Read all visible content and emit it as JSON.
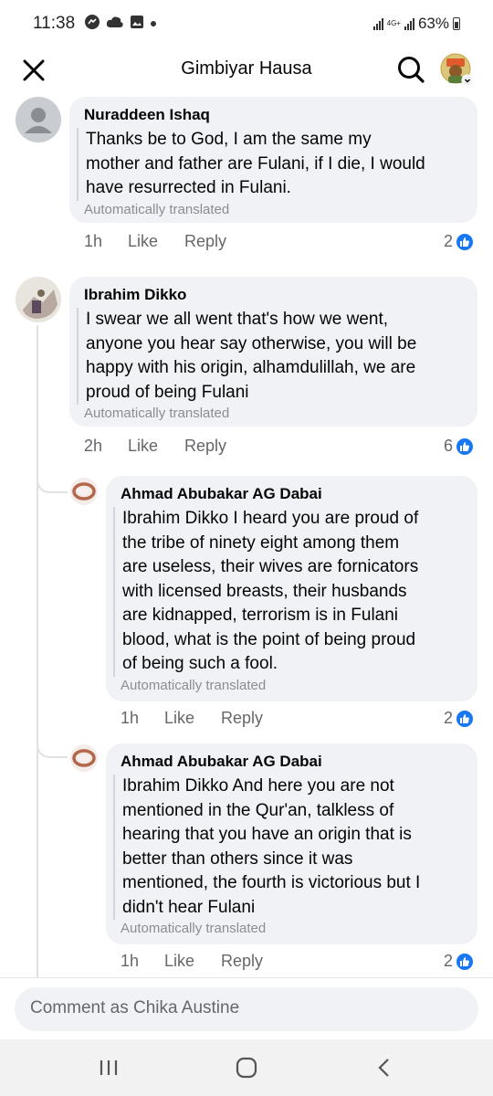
{
  "status_bar": {
    "time": "11:38",
    "network": "4G+",
    "battery": "63%"
  },
  "header": {
    "title": "Gimbiyar Hausa"
  },
  "comments": [
    {
      "author": "Nuraddeen Ishaq",
      "lines": [
        "Thanks be to God, I am the same my",
        "mother and father are Fulani, if I die, I would",
        "have resurrected in Fulani."
      ],
      "translated": "Automatically translated",
      "time": "1h",
      "like": "Like",
      "reply": "Reply",
      "reactions": "2"
    },
    {
      "author": "Ibrahim Dikko",
      "lines": [
        "I swear we all went that's how we went,",
        "anyone you hear say otherwise, you will be",
        "happy with his origin, alhamdulillah, we are",
        "proud of being Fulani"
      ],
      "translated": "Automatically translated",
      "time": "2h",
      "like": "Like",
      "reply": "Reply",
      "reactions": "6"
    },
    {
      "author": "Ahmad Abubakar AG Dabai",
      "lines": [
        "Ibrahim Dikko I heard you are proud of",
        "the tribe of ninety eight among them",
        "are useless, their wives are fornicators",
        "with licensed breasts, their husbands",
        "are kidnapped, terrorism is in Fulani",
        "blood, what is the point of being proud",
        "of being such a fool."
      ],
      "translated": "Automatically translated",
      "time": "1h",
      "like": "Like",
      "reply": "Reply",
      "reactions": "2"
    },
    {
      "author": "Ahmad Abubakar AG Dabai",
      "lines": [
        "Ibrahim Dikko And here you are not",
        "mentioned in the Qur'an, talkless of",
        "hearing that you have an origin that is",
        "better than others since it was",
        "mentioned, the fourth is victorious but I",
        "didn't hear Fulani"
      ],
      "translated": "Automatically translated",
      "time": "1h",
      "like": "Like",
      "reply": "Reply",
      "reactions": "2"
    }
  ],
  "composer": {
    "placeholder": "Comment as Chika Austine"
  },
  "icons": {
    "close": "close-icon",
    "search": "search-icon",
    "like_reaction": "thumbs-up-icon",
    "recents": "recents-icon",
    "home": "home-icon",
    "back": "back-icon"
  },
  "colors": {
    "accent": "#1877f2",
    "bubble": "#f0f2f5",
    "meta_text": "#65676b"
  }
}
